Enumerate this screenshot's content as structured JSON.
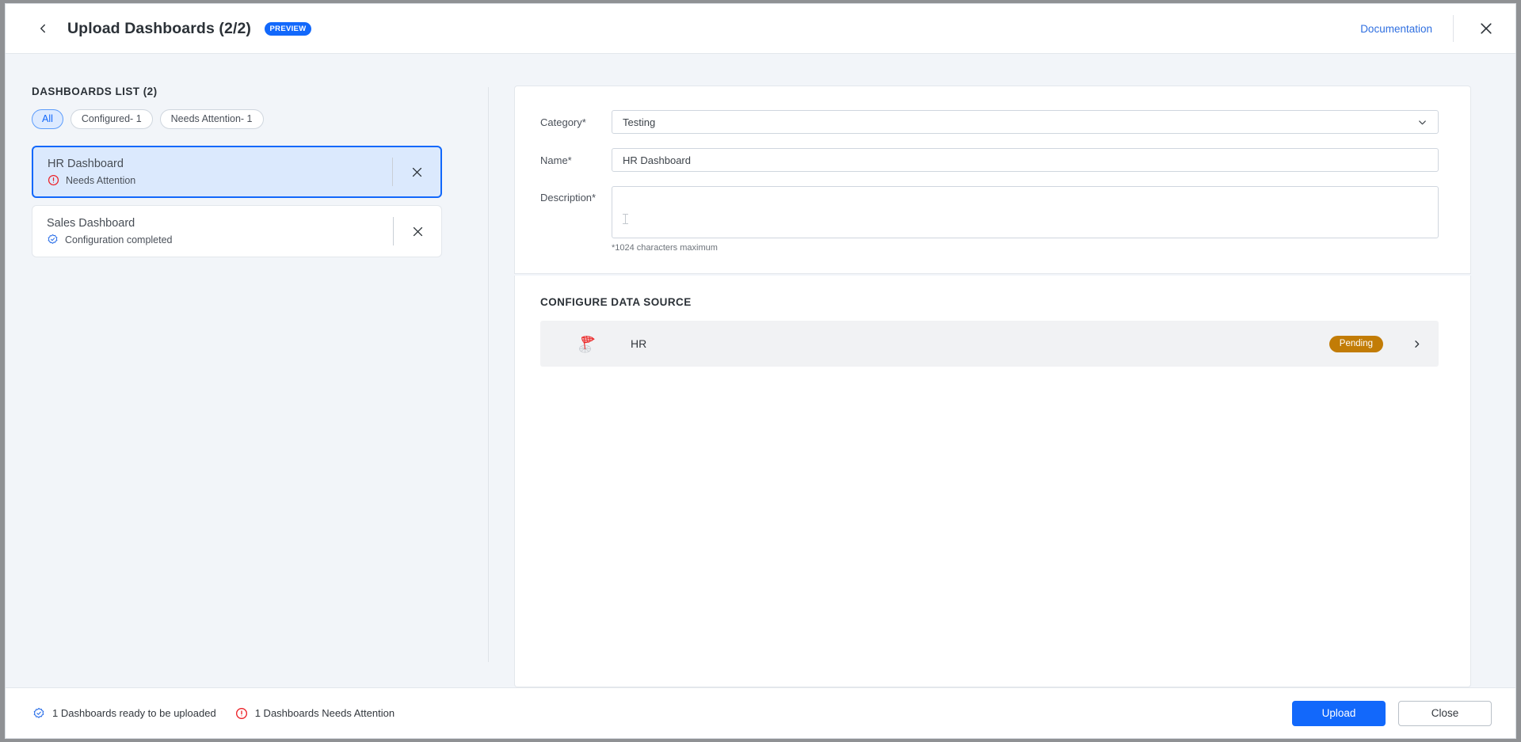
{
  "header": {
    "back_icon": "chevron-left-icon",
    "title": "Upload Dashboards (2/2)",
    "badge": "PREVIEW",
    "documentation_label": "Documentation",
    "close_icon": "close-icon"
  },
  "sidebar": {
    "list_title": "DASHBOARDS LIST (2)",
    "filters": [
      {
        "label": "All",
        "active": true
      },
      {
        "label": "Configured- 1",
        "active": false
      },
      {
        "label": "Needs Attention- 1",
        "active": false
      }
    ],
    "cards": [
      {
        "name": "HR Dashboard",
        "status": "Needs Attention",
        "status_icon": "alert-circle-icon",
        "selected": true,
        "remove_icon": "close-icon"
      },
      {
        "name": "Sales Dashboard",
        "status": "Configuration completed",
        "status_icon": "badge-check-icon",
        "selected": false,
        "remove_icon": "close-icon"
      }
    ]
  },
  "form": {
    "category": {
      "label": "Category*",
      "value": "Testing",
      "chevron_icon": "chevron-down-icon"
    },
    "name": {
      "label": "Name*",
      "value": "HR Dashboard",
      "placeholder": ""
    },
    "description": {
      "label": "Description*",
      "value": "",
      "placeholder": "",
      "hint": "*1024 characters maximum"
    }
  },
  "data_source": {
    "section_title": "CONFIGURE DATA SOURCE",
    "rows": [
      {
        "icon": "sql-server-analysis-services-icon",
        "name": "HR",
        "status": "Pending",
        "status_color": "#c27c06",
        "chevron_icon": "chevron-right-icon"
      }
    ]
  },
  "footer": {
    "statuses": [
      {
        "icon": "badge-check-icon",
        "text": "1 Dashboards ready to be uploaded"
      },
      {
        "icon": "alert-circle-icon",
        "text": "1 Dashboards Needs Attention"
      }
    ],
    "upload_label": "Upload",
    "close_label": "Close"
  },
  "colors": {
    "accent_blue": "#1268fb",
    "alert_red": "#ec2027",
    "pending_amber": "#c27c06",
    "page_bg": "#f2f5f9"
  }
}
